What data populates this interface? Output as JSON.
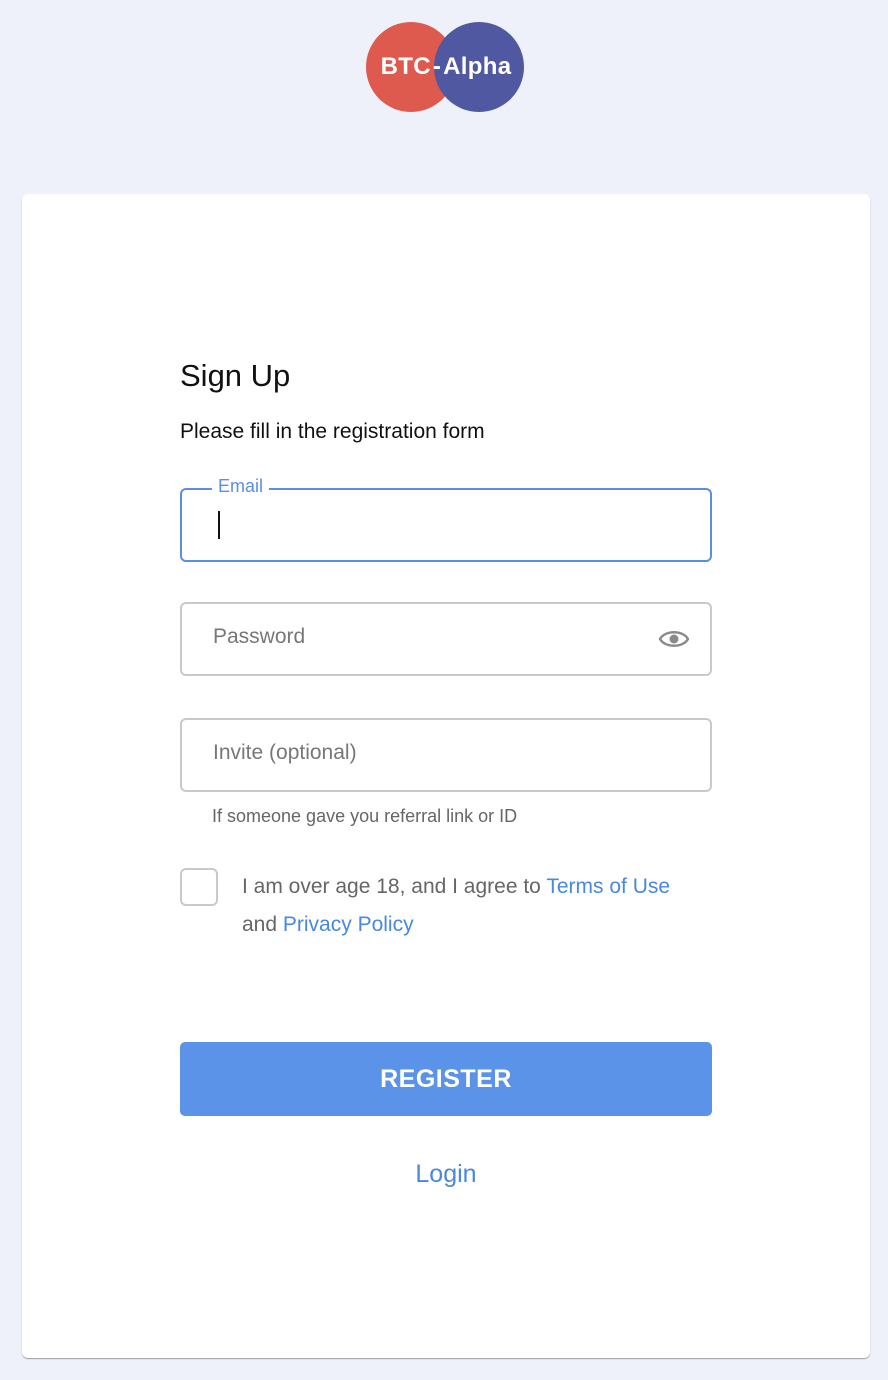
{
  "logo": {
    "part1": "BTC",
    "separator": "-",
    "part2": "Alpha",
    "colors": {
      "left": "#de5a4e",
      "right": "#4f58a0"
    }
  },
  "form": {
    "title": "Sign Up",
    "subtitle": "Please fill in the registration form",
    "email": {
      "label": "Email",
      "value": ""
    },
    "password": {
      "placeholder": "Password",
      "icon": "eye-icon"
    },
    "invite": {
      "placeholder": "Invite (optional)",
      "helper": "If someone gave you referral link or ID"
    },
    "agree": {
      "text_before": "I am over age 18, and I agree to",
      "terms_link": "Terms of Use",
      "text_middle": "and",
      "privacy_link": "Privacy Policy",
      "checked": false
    },
    "register_label": "REGISTER",
    "login_label": "Login"
  },
  "colors": {
    "accent": "#5b93e8",
    "link": "#4a87e0",
    "background": "#eef1fa"
  }
}
